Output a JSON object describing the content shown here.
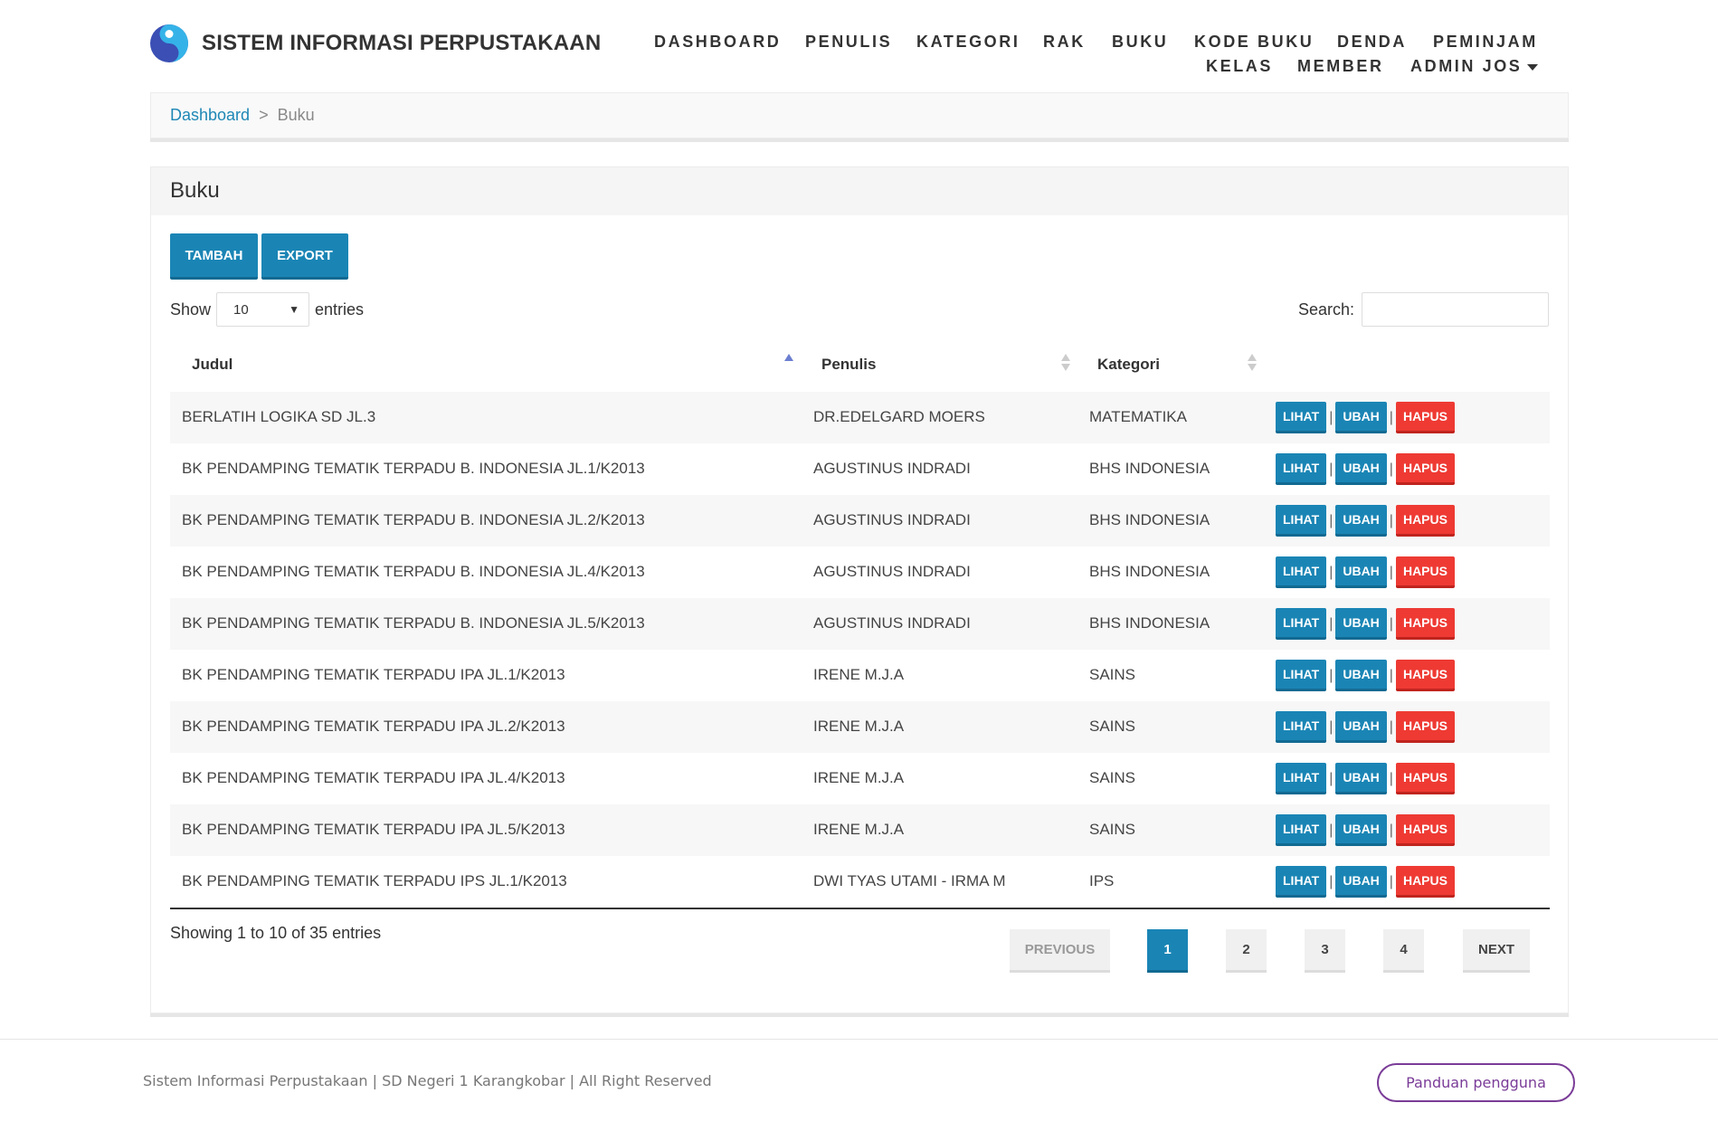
{
  "app": {
    "title": "SISTEM INFORMASI PERPUSTAKAAN"
  },
  "nav": {
    "row1": [
      "DASHBOARD",
      "PENULIS",
      "KATEGORI",
      "RAK",
      "BUKU",
      "KODE BUKU",
      "DENDA",
      "PEMINJAM"
    ],
    "row2": [
      "KELAS",
      "MEMBER",
      "ADMIN JOS"
    ]
  },
  "breadcrumb": {
    "home": "Dashboard",
    "separator": ">",
    "current": "Buku"
  },
  "panel": {
    "title": "Buku",
    "add_label": "TAMBAH",
    "export_label": "EXPORT",
    "show_label": "Show",
    "entries_label": "entries",
    "page_size": "10",
    "search_label": "Search:",
    "search_value": ""
  },
  "table": {
    "columns": [
      "Judul",
      "Penulis",
      "Kategori"
    ],
    "sorted_column": "Judul",
    "sort_direction": "asc",
    "action_labels": {
      "view": "LIHAT",
      "edit": "UBAH",
      "delete": "HAPUS"
    },
    "rows": [
      [
        "BERLATIH LOGIKA SD JL.3",
        "DR.EDELGARD MOERS",
        "MATEMATIKA"
      ],
      [
        "BK PENDAMPING TEMATIK TERPADU B. INDONESIA JL.1/K2013",
        "AGUSTINUS INDRADI",
        "BHS INDONESIA"
      ],
      [
        "BK PENDAMPING TEMATIK TERPADU B. INDONESIA JL.2/K2013",
        "AGUSTINUS INDRADI",
        "BHS INDONESIA"
      ],
      [
        "BK PENDAMPING TEMATIK TERPADU B. INDONESIA JL.4/K2013",
        "AGUSTINUS INDRADI",
        "BHS INDONESIA"
      ],
      [
        "BK PENDAMPING TEMATIK TERPADU B. INDONESIA JL.5/K2013",
        "AGUSTINUS INDRADI",
        "BHS INDONESIA"
      ],
      [
        "BK PENDAMPING TEMATIK TERPADU IPA JL.1/K2013",
        "IRENE M.J.A",
        "SAINS"
      ],
      [
        "BK PENDAMPING TEMATIK TERPADU IPA JL.2/K2013",
        "IRENE M.J.A",
        "SAINS"
      ],
      [
        "BK PENDAMPING TEMATIK TERPADU IPA JL.4/K2013",
        "IRENE M.J.A",
        "SAINS"
      ],
      [
        "BK PENDAMPING TEMATIK TERPADU IPA JL.5/K2013",
        "IRENE M.J.A",
        "SAINS"
      ],
      [
        "BK PENDAMPING TEMATIK TERPADU IPS JL.1/K2013",
        "DWI TYAS UTAMI - IRMA M",
        "IPS"
      ]
    ]
  },
  "pagination": {
    "info": "Showing 1 to 10 of 35 entries",
    "previous": "PREVIOUS",
    "next": "NEXT",
    "pages": [
      "1",
      "2",
      "3",
      "4"
    ],
    "current_page": "1"
  },
  "footer": {
    "copyright": "Sistem Informasi Perpustakaan | SD Negeri 1 Karangkobar | All Right Reserved",
    "guide_label": "Panduan pengguna"
  },
  "colors": {
    "primary": "#1a85b5",
    "danger": "#ee3a33",
    "guide": "#7a3c98"
  }
}
